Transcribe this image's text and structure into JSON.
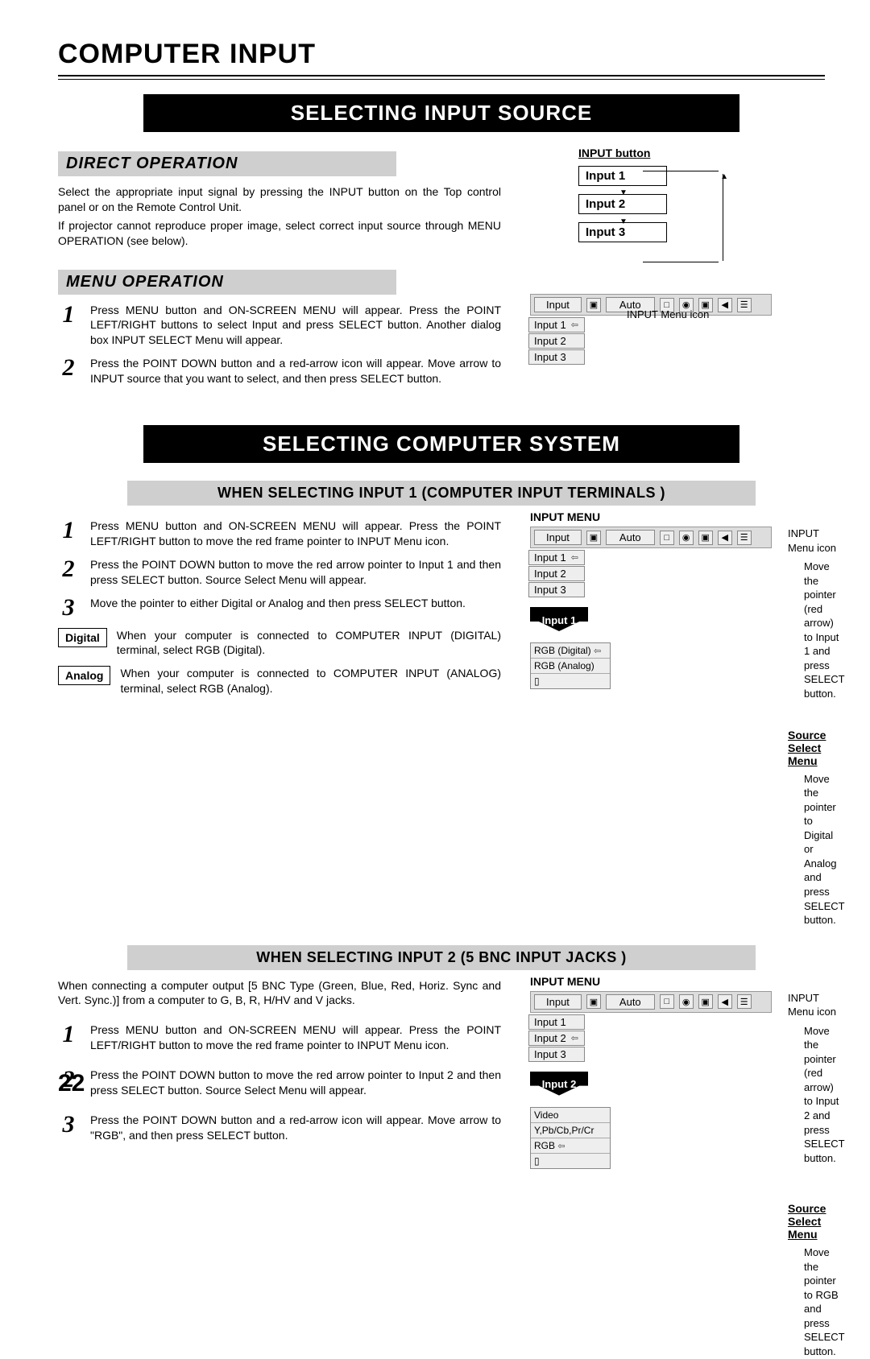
{
  "page": {
    "title": "COMPUTER INPUT",
    "number": "22"
  },
  "bars": {
    "selecting_input_source": "SELECTING INPUT SOURCE",
    "selecting_computer_system": "SELECTING COMPUTER SYSTEM",
    "direct_operation": "DIRECT OPERATION",
    "menu_operation": "MENU OPERATION",
    "when_input1": "WHEN SELECTING  INPUT 1 (COMPUTER INPUT TERMINALS )",
    "when_input2": "WHEN SELECTING INPUT 2 (5 BNC INPUT JACKS )"
  },
  "direct_operation": {
    "p1": "Select the appropriate input signal by pressing the INPUT button on the Top control panel or on the Remote Control Unit.",
    "p2": "If projector cannot reproduce proper image, select correct input source through MENU OPERATION (see below)."
  },
  "input_button": {
    "title": "INPUT button",
    "items": [
      "Input 1",
      "Input 2",
      "Input 3"
    ]
  },
  "menu_operation": {
    "step1": "Press MENU button and ON-SCREEN MENU will appear.  Press the POINT LEFT/RIGHT buttons to select Input and press SELECT button.  Another dialog box INPUT SELECT Menu will appear.",
    "step2": "Press the POINT DOWN button and a red-arrow icon will appear.  Move arrow to INPUT source that you want to select, and then press SELECT button.",
    "menu_label": "Input",
    "auto_label": "Auto",
    "rows": [
      "Input 1",
      "Input 2",
      "Input 3"
    ],
    "callout": "INPUT Menu icon"
  },
  "input1": {
    "step1": "Press MENU button and ON-SCREEN MENU will appear.  Press the POINT LEFT/RIGHT button to move the red frame pointer to INPUT Menu icon.",
    "step2": "Press the POINT DOWN button to move the red arrow pointer to Input 1 and then press SELECT button.  Source Select Menu will appear.",
    "step3": "Move the pointer to either Digital or Analog and then press SELECT button.",
    "digital_label": "Digital",
    "digital_text": "When your computer is connected to COMPUTER INPUT (DIGITAL) terminal, select RGB (Digital).",
    "analog_label": "Analog",
    "analog_text": "When your computer is connected to COMPUTER INPUT (ANALOG) terminal, select RGB (Analog).",
    "menu_title": "INPUT MENU",
    "callout_icon": "INPUT Menu icon",
    "callout_move": "Move the pointer (red arrow) to Input 1 and press SELECT button.",
    "down_label": "Input 1",
    "source_title": "Source Select Menu",
    "source_rows": [
      "RGB (Digital)",
      "RGB (Analog)"
    ],
    "source_callout": "Move the pointer to Digital or Analog and press SELECT button."
  },
  "input2": {
    "intro": "When connecting a computer output [5 BNC Type (Green, Blue, Red, Horiz. Sync and Vert. Sync.)] from a computer to G, B, R, H/HV and V jacks.",
    "step1": "Press MENU button and ON-SCREEN MENU will appear.  Press the POINT LEFT/RIGHT button to move the red frame pointer to INPUT Menu icon.",
    "step2": "Press the POINT DOWN button to move the red arrow pointer to Input 2 and then press SELECT button.  Source Select Menu will appear.",
    "step3": "Press the POINT DOWN button and a red-arrow icon will appear.  Move arrow to \"RGB\", and then press SELECT button.",
    "menu_title": "INPUT MENU",
    "callout_icon": "INPUT Menu icon",
    "callout_move": "Move the pointer (red arrow) to Input 2 and press SELECT button.",
    "down_label": "Input 2",
    "source_title": "Source Select Menu",
    "source_rows": [
      "Video",
      "Y,Pb/Cb,Pr/Cr",
      "RGB"
    ],
    "source_callout": "Move the pointer to RGB and press SELECT button."
  }
}
